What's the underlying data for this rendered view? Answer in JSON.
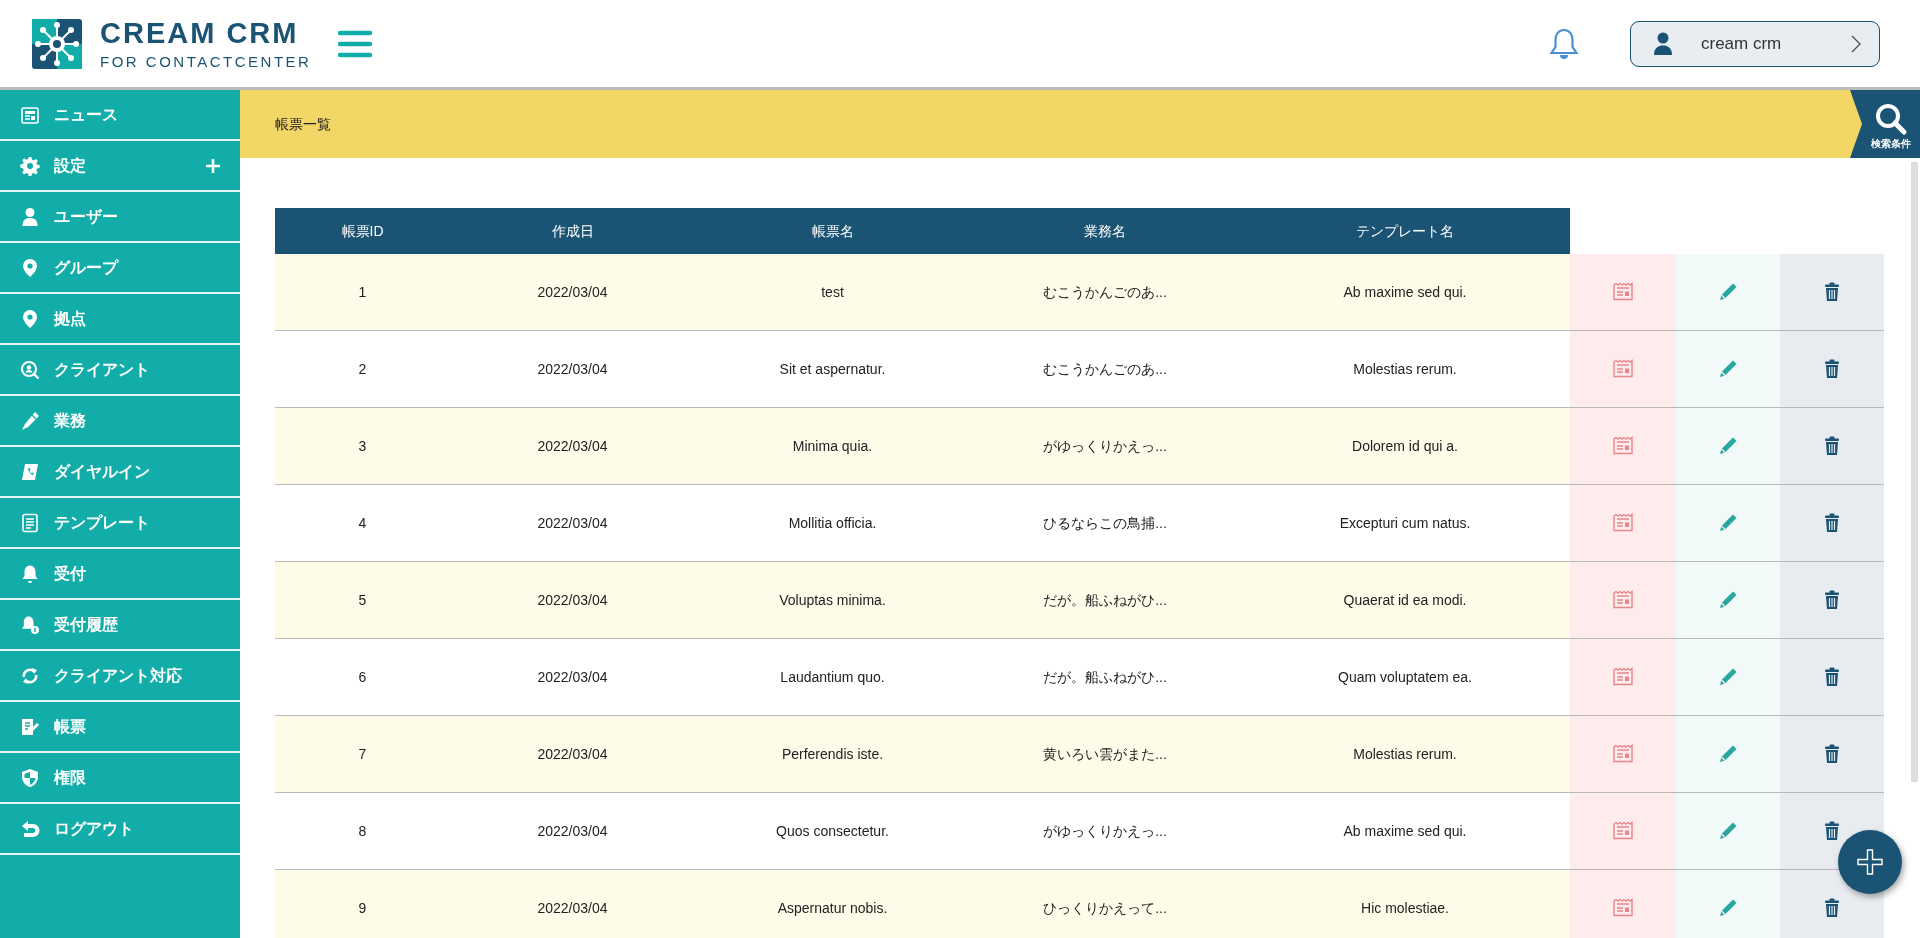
{
  "header": {
    "logo_title": "CREAM CRM",
    "logo_subtitle": "FOR CONTACTCENTER",
    "user": {
      "name": "cream crm"
    }
  },
  "sidebar": {
    "items": [
      {
        "label": "ニュース",
        "kind": "link"
      },
      {
        "label": "設定",
        "kind": "group",
        "expanded": false
      },
      {
        "label": "ユーザー",
        "kind": "link"
      },
      {
        "label": "グループ",
        "kind": "link"
      },
      {
        "label": "拠点",
        "kind": "link"
      },
      {
        "label": "クライアント",
        "kind": "link"
      },
      {
        "label": "業務",
        "kind": "link"
      },
      {
        "label": "ダイヤルイン",
        "kind": "link"
      },
      {
        "label": "テンプレート",
        "kind": "link"
      },
      {
        "label": "受付",
        "kind": "link"
      },
      {
        "label": "受付履歴",
        "kind": "link"
      },
      {
        "label": "クライアント対応",
        "kind": "link"
      },
      {
        "label": "帳票",
        "kind": "link"
      },
      {
        "label": "権限",
        "kind": "link"
      },
      {
        "label": "ログアウト",
        "kind": "link"
      }
    ]
  },
  "page": {
    "title": "帳票一覧",
    "search_button": "検索条件"
  },
  "table": {
    "columns": [
      "帳票ID",
      "作成日",
      "帳票名",
      "業務名",
      "テンプレート名"
    ],
    "rows": [
      [
        "1",
        "2022/03/04",
        "test",
        "むこうかんごのあ...",
        "Ab maxime sed qui."
      ],
      [
        "2",
        "2022/03/04",
        "Sit et aspernatur.",
        "むこうかんごのあ...",
        "Molestias rerum."
      ],
      [
        "3",
        "2022/03/04",
        "Minima quia.",
        "がゆっくりかえっ...",
        "Dolorem id qui a."
      ],
      [
        "4",
        "2022/03/04",
        "Mollitia officia.",
        "ひるならこの鳥捕...",
        "Excepturi cum natus."
      ],
      [
        "5",
        "2022/03/04",
        "Voluptas minima.",
        "だが。船ふねがひ...",
        "Quaerat id ea modi."
      ],
      [
        "6",
        "2022/03/04",
        "Laudantium quo.",
        "だが。船ふねがひ...",
        "Quam voluptatem ea."
      ],
      [
        "7",
        "2022/03/04",
        "Perferendis iste.",
        "黄いろい雲がまた...",
        "Molestias rerum."
      ],
      [
        "8",
        "2022/03/04",
        "Quos consectetur.",
        "がゆっくりかえっ...",
        "Ab maxime sed qui."
      ],
      [
        "9",
        "2022/03/04",
        "Aspernatur nobis.",
        "ひっくりかえって...",
        "Hic molestiae."
      ]
    ]
  }
}
